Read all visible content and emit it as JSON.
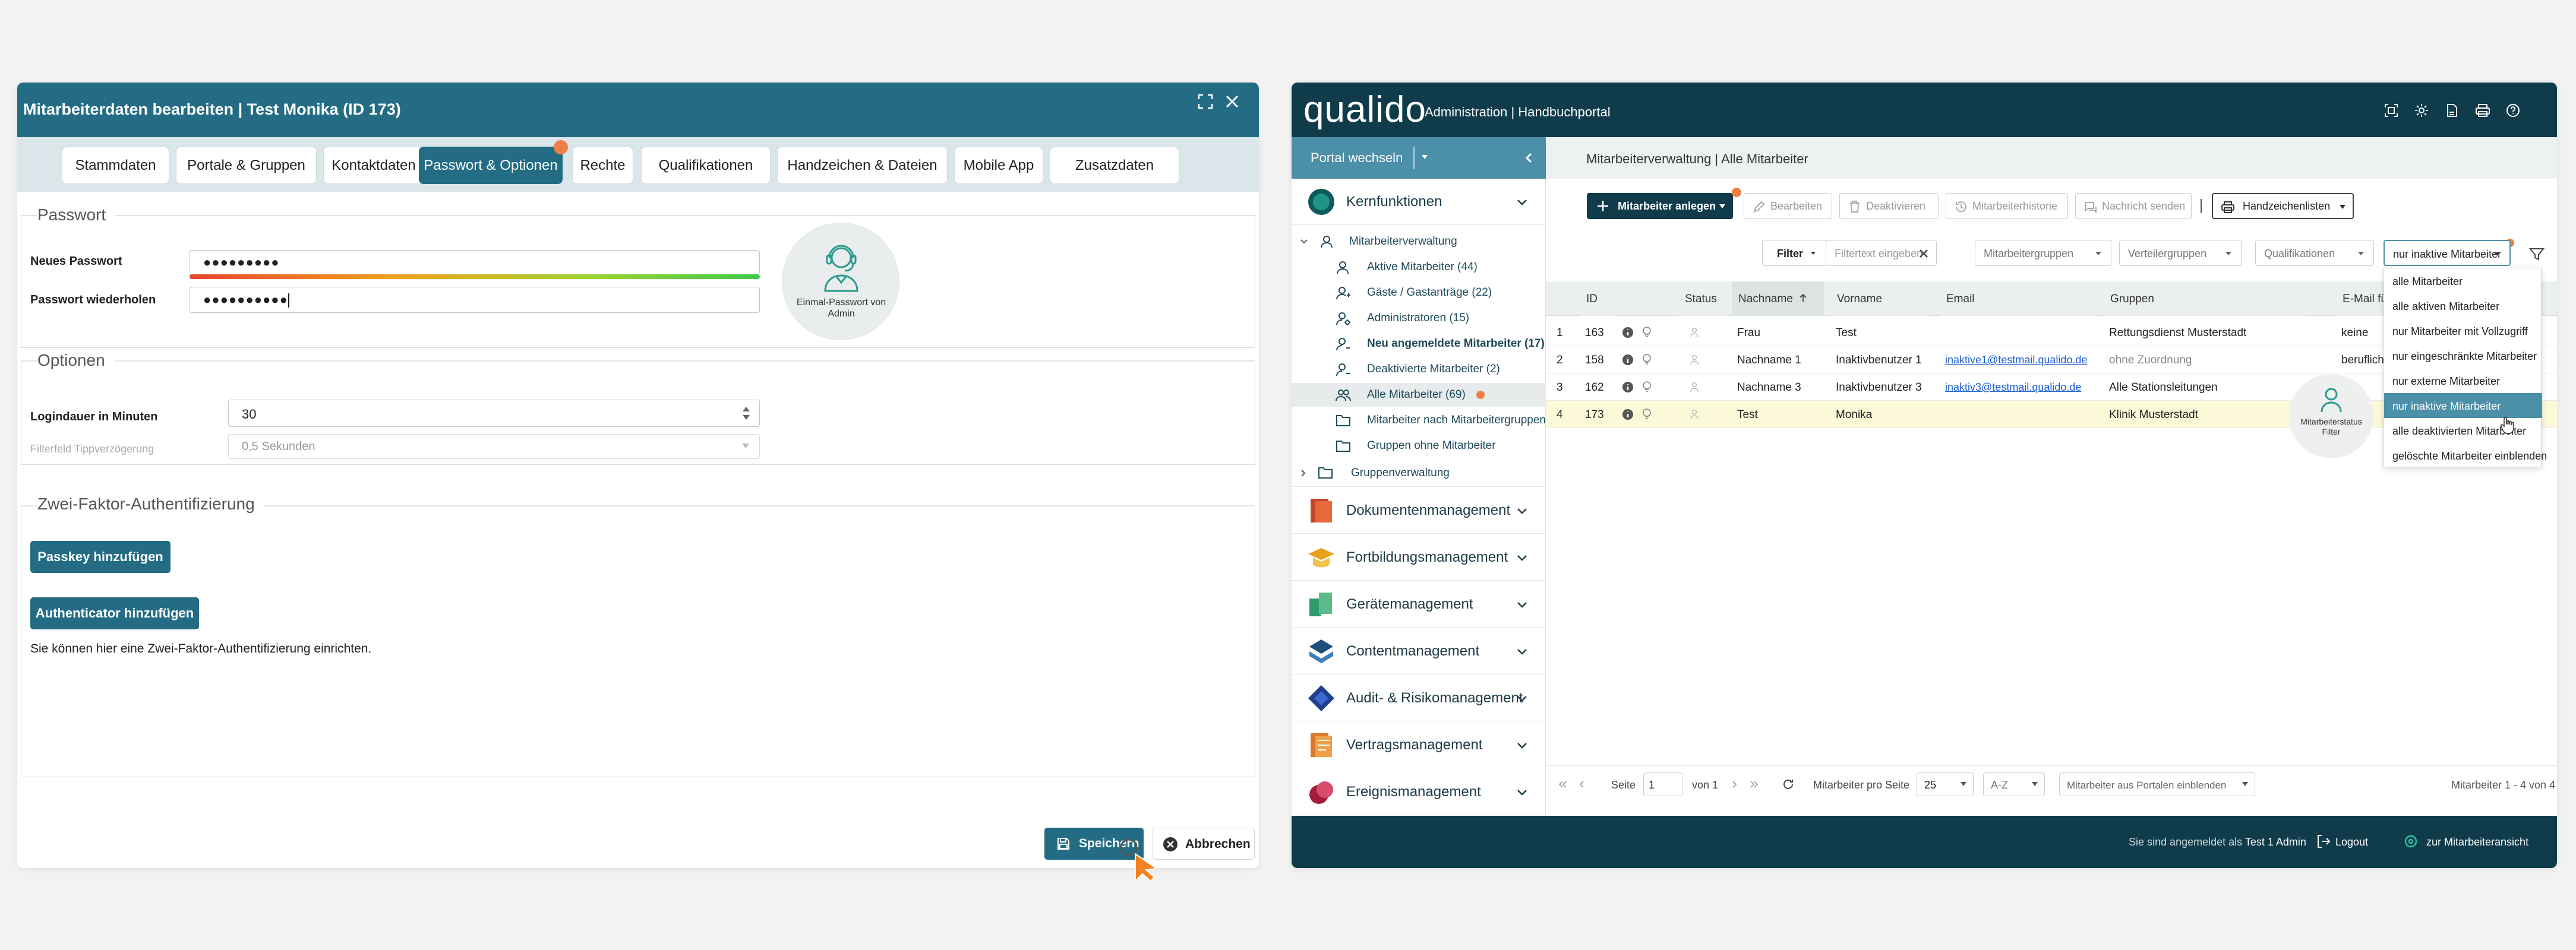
{
  "left_window": {
    "title": "Mitarbeiterdaten bearbeiten | Test Monika (ID 173)",
    "tabs": [
      "Stammdaten",
      "Portale & Gruppen",
      "Kontaktdaten",
      "Passwort & Optionen",
      "Rechte",
      "Qualifikationen",
      "Handzeichen & Dateien",
      "Mobile App",
      "Zusatzdaten"
    ],
    "active_tab": "Passwort & Optionen",
    "password_section": {
      "title": "Passwort",
      "new_label": "Neues Passwort",
      "new_value": "●●●●●●●●●",
      "repeat_label": "Passwort wiederholen",
      "repeat_value": "●●●●●●●●●●",
      "onetime_label": "Einmal-Passwort von Admin"
    },
    "options_section": {
      "title": "Optionen",
      "login_label": "Logindauer in Minuten",
      "login_value": "30",
      "filter_label": "Filterfeld Tippverzögerung",
      "filter_value": "0,5 Sekunden"
    },
    "twofa_section": {
      "title": "Zwei-Faktor-Authentifizierung",
      "passkey_button": "Passkey hinzufügen",
      "authenticator_button": "Authenticator hinzufügen",
      "info": "Sie können hier eine Zwei-Faktor-Authentifizierung einrichten."
    },
    "save_button": "Speichern",
    "cancel_button": "Abbrechen"
  },
  "app": {
    "logo": "qualido",
    "subtitle": "Administration | Handbuchportal",
    "portal_switch": "Portal wechseln",
    "breadcrumb": "Mitarbeiterverwaltung | Alle Mitarbeiter",
    "sidebar": {
      "kernfunktionen": "Kernfunktionen",
      "mitarbeiterverwaltung": "Mitarbeiterverwaltung",
      "items": [
        "Aktive Mitarbeiter (44)",
        "Gäste / Gastanträge (22)",
        "Administratoren (15)",
        "Neu angemeldete Mitarbeiter (17)",
        "Deaktivierte Mitarbeiter (2)",
        "Alle Mitarbeiter (69)",
        "Mitarbeiter nach Mitarbeitergruppen",
        "Gruppen ohne Mitarbeiter"
      ],
      "gruppenverwaltung": "Gruppenverwaltung",
      "modules": [
        "Dokumentenmanagement",
        "Fortbildungsmanagement",
        "Gerätemanagement",
        "Contentmanagement",
        "Audit- & Risikomanagement",
        "Vertragsmanagement",
        "Ereignismanagement"
      ]
    },
    "toolbar": {
      "create": "Mitarbeiter anlegen",
      "edit": "Bearbeiten",
      "deactivate": "Deaktivieren",
      "history": "Mitarbeiterhistorie",
      "message": "Nachricht senden",
      "sign_lists": "Handzeichenlisten"
    },
    "filters": {
      "filter_label": "Filter",
      "filter_placeholder": "Filtertext eingeben",
      "groups": "Mitarbeitergruppen",
      "distribution": "Verteilergruppen",
      "qualifications": "Qualifikationen",
      "status_selected": "nur inaktive Mitarbeiter"
    },
    "table": {
      "headers": [
        "ID",
        "Status",
        "Nachname",
        "Vorname",
        "Email",
        "Gruppen",
        "E-Mail fü"
      ],
      "rows": [
        {
          "n": "1",
          "id": "163",
          "nachname": "Frau",
          "vorname": "Test",
          "email": "",
          "gruppen": "Rettungsdienst Musterstadt",
          "extra": "keine"
        },
        {
          "n": "2",
          "id": "158",
          "nachname": "Nachname 1",
          "vorname": "Inaktivbenutzer 1",
          "email": "inaktive1@testmail.qualido.de",
          "gruppen": "ohne Zuordnung",
          "extra": "beruflich"
        },
        {
          "n": "3",
          "id": "162",
          "nachname": "Nachname 3",
          "vorname": "Inaktivbenutzer 3",
          "email": "inaktiv3@testmail.qualido.de",
          "gruppen": "Alle Stationsleitungen",
          "extra": ""
        },
        {
          "n": "4",
          "id": "173",
          "nachname": "Test",
          "vorname": "Monika",
          "email": "",
          "gruppen": "Klinik Musterstadt",
          "extra": ""
        }
      ]
    },
    "status_dropdown": [
      "alle Mitarbeiter",
      "alle aktiven Mitarbeiter",
      "nur Mitarbeiter mit Vollzugriff",
      "nur eingeschränkte Mitarbeiter",
      "nur externe Mitarbeiter",
      "nur inaktive Mitarbeiter",
      "alle deaktivierten Mitarbeiter",
      "gelöschte Mitarbeiter einblenden"
    ],
    "status_filter_tooltip": "Mitarbeiterstatus Filter",
    "pagination": {
      "page_label": "Seite",
      "page_value": "1",
      "of_label": "von 1",
      "per_page_label": "Mitarbeiter pro Seite",
      "per_page_value": "25",
      "sort_value": "A-Z",
      "portal_toggle": "Mitarbeiter aus Portalen einblenden",
      "range": "Mitarbeiter 1 - 4 von 4"
    },
    "footer": {
      "logged_in_prefix": "Sie sind angemeldet als",
      "user": "Test 1 Admin",
      "logout": "Logout",
      "employee_view": "zur Mitarbeiteransicht"
    }
  },
  "colors": {
    "teal": "#236c84",
    "dark_navy": "#0f3b4a",
    "orange": "#f07f47",
    "selected_row": "#fbf9d8"
  }
}
